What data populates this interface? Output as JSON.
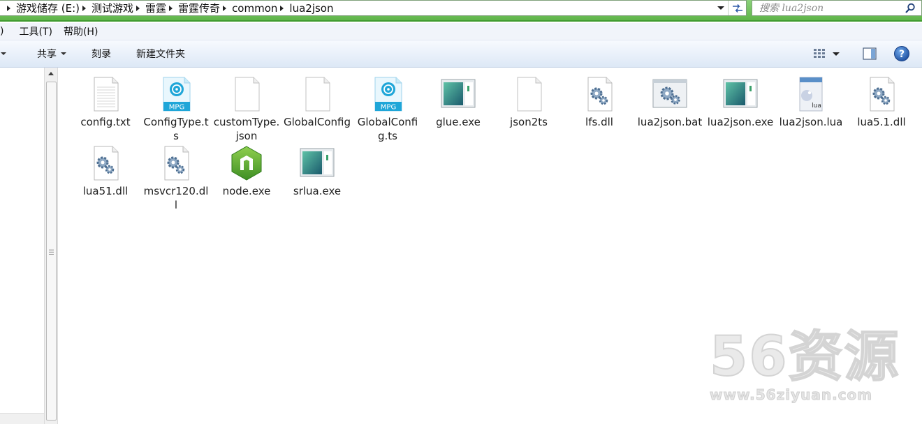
{
  "address_bar": {
    "crumbs": [
      "游戏储存 (E:)",
      "测试游戏",
      "雷霆",
      "雷霆传奇",
      "common",
      "lua2json"
    ]
  },
  "search": {
    "placeholder": "搜索 lua2json"
  },
  "menu": {
    "fragment": ")",
    "tools": "工具(T)",
    "help": "帮助(H)"
  },
  "commands": {
    "share": "共享",
    "burn": "刻录",
    "new_folder": "新建文件夹"
  },
  "files": [
    {
      "name": "config.txt",
      "icon": "text-file-icon"
    },
    {
      "name": "ConfigType.ts",
      "icon": "mpg-video-file-icon",
      "badge": "MPG"
    },
    {
      "name": "customType.json",
      "icon": "blank-file-icon"
    },
    {
      "name": "GlobalConfig",
      "icon": "blank-file-icon"
    },
    {
      "name": "GlobalConfig.ts",
      "icon": "mpg-video-file-icon",
      "badge": "MPG"
    },
    {
      "name": "glue.exe",
      "icon": "exe-window-icon"
    },
    {
      "name": "json2ts",
      "icon": "blank-file-icon"
    },
    {
      "name": "lfs.dll",
      "icon": "dll-gears-icon"
    },
    {
      "name": "lua2json.bat",
      "icon": "bat-gears-icon"
    },
    {
      "name": "lua2json.exe",
      "icon": "exe-window-icon"
    },
    {
      "name": "lua2json.lua",
      "icon": "lua-file-icon",
      "badge": "lua"
    },
    {
      "name": "lua5.1.dll",
      "icon": "dll-gears-icon"
    },
    {
      "name": "lua51.dll",
      "icon": "dll-gears-icon"
    },
    {
      "name": "msvcr120.dll",
      "icon": "dll-gears-icon"
    },
    {
      "name": "node.exe",
      "icon": "nodejs-hexagon-icon"
    },
    {
      "name": "srlua.exe",
      "icon": "exe-window-icon"
    }
  ],
  "watermark": {
    "big": "56资源",
    "small": "www.56ziyuan.com"
  },
  "colors": {
    "address_green": "#5fb449",
    "cmdbar_blue": "#dde8f6",
    "mpg_blue": "#1fa6d8",
    "node_green": "#6cb33f"
  }
}
